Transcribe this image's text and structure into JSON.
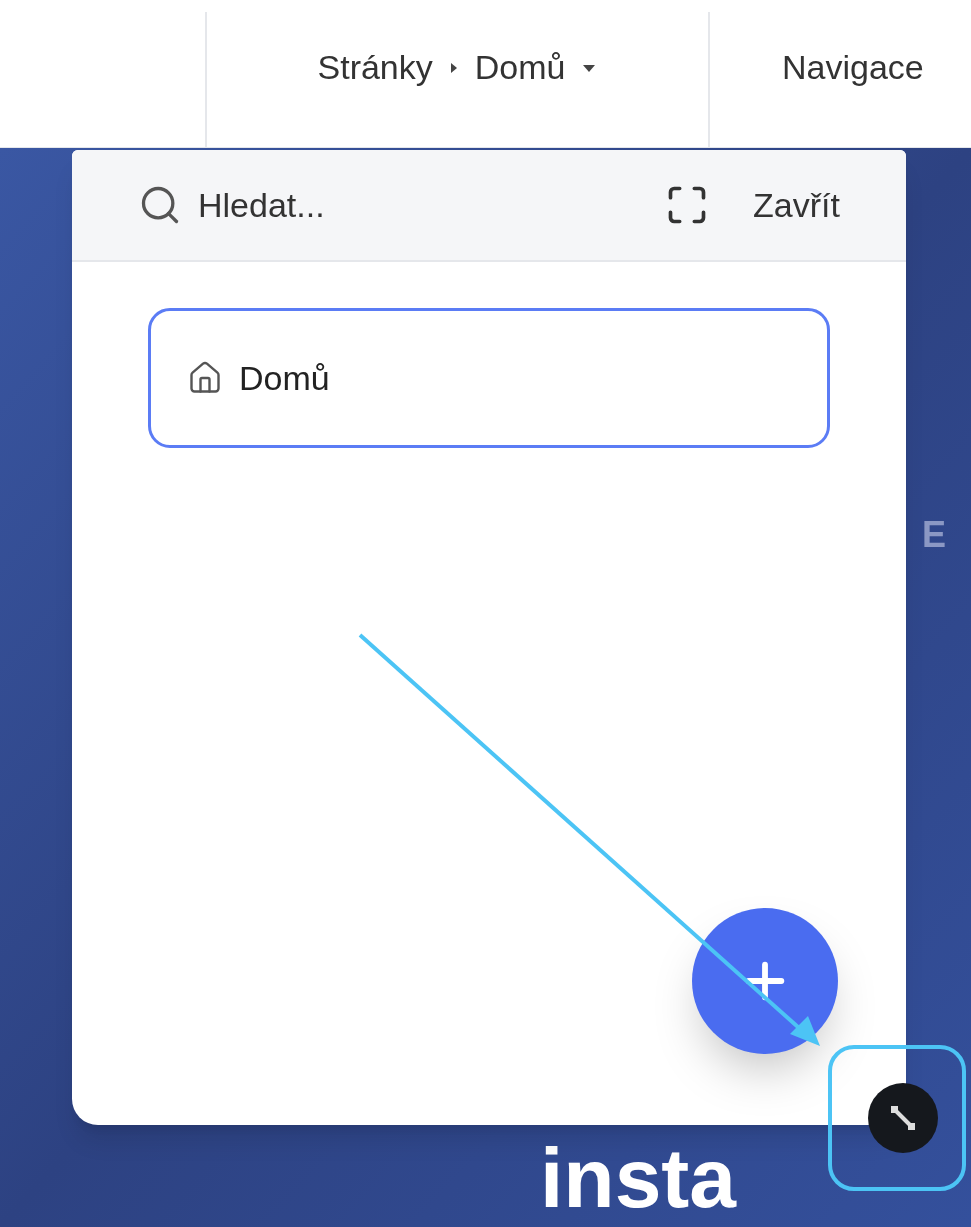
{
  "breadcrumb": {
    "items": [
      "Stránky",
      "Domů"
    ]
  },
  "nav_label": "Navigace",
  "panel": {
    "search": {
      "placeholder": "Hledat..."
    },
    "close_label": "Zavřít",
    "items": [
      {
        "label": "Domů",
        "selected": true
      }
    ]
  },
  "background": {
    "side_letter": "E",
    "heading": "insta"
  }
}
